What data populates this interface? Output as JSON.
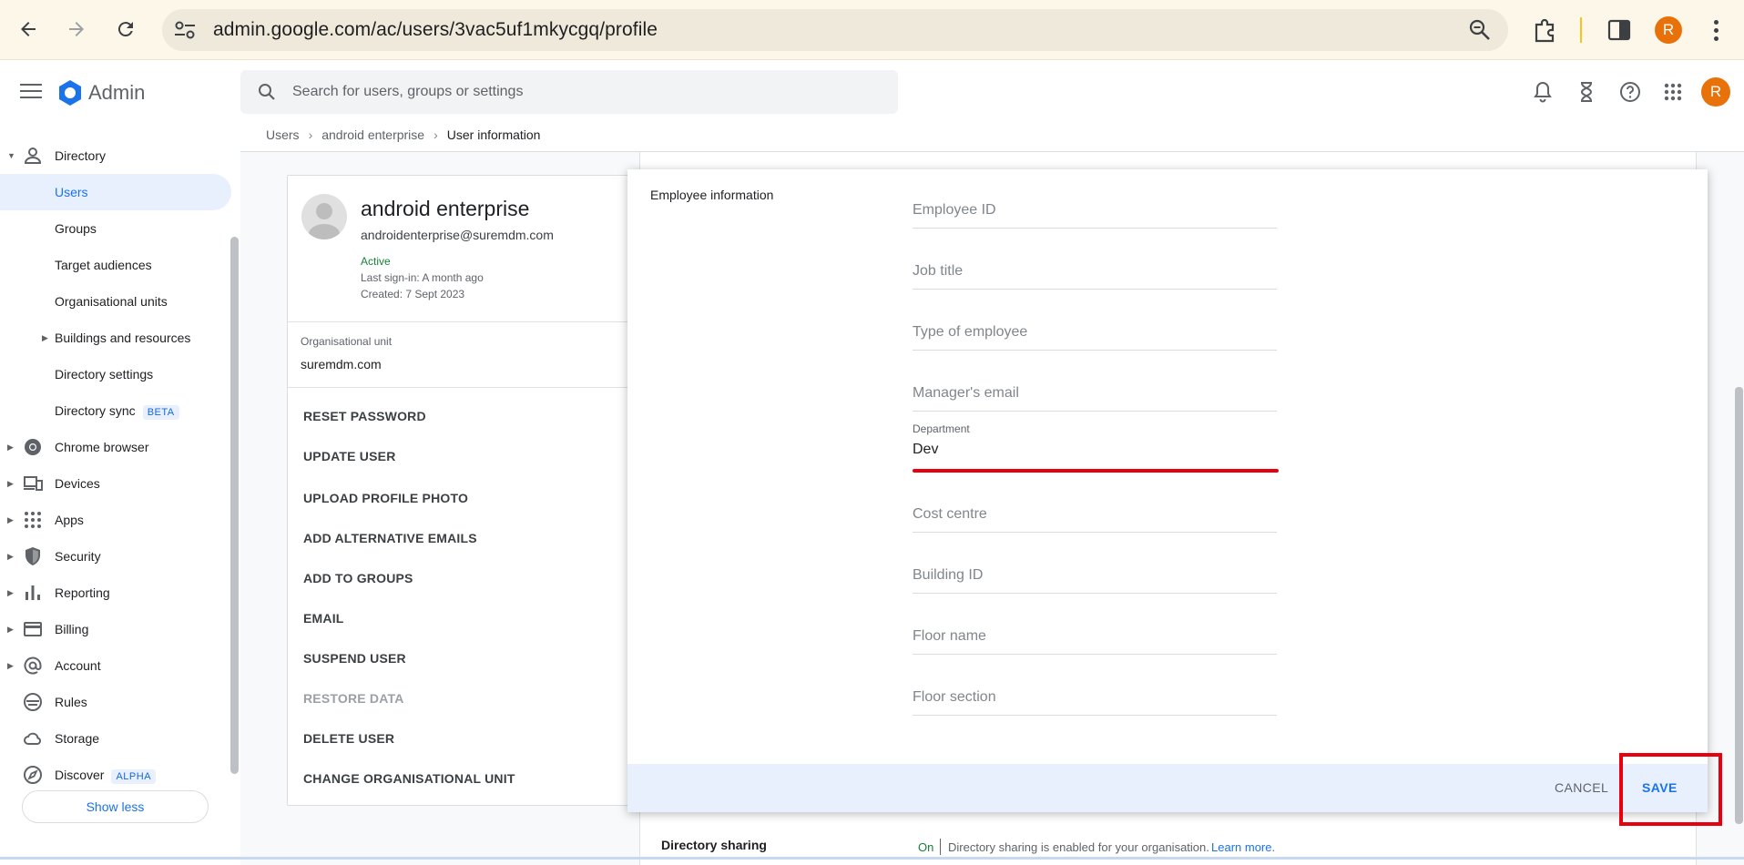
{
  "browser": {
    "url": "admin.google.com/ac/users/3vac5uf1mkycgq/profile",
    "profile_initial": "R"
  },
  "header": {
    "app_title": "Admin",
    "search_placeholder": "Search for users, groups or settings",
    "profile_initial": "R"
  },
  "breadcrumb": {
    "items": [
      "Users",
      "android enterprise",
      "User information"
    ]
  },
  "sidebar": {
    "items": [
      {
        "label": "Directory"
      },
      {
        "label": "Users"
      },
      {
        "label": "Groups"
      },
      {
        "label": "Target audiences"
      },
      {
        "label": "Organisational units"
      },
      {
        "label": "Buildings and resources"
      },
      {
        "label": "Directory settings"
      },
      {
        "label": "Directory sync",
        "badge": "BETA"
      },
      {
        "label": "Chrome browser"
      },
      {
        "label": "Devices"
      },
      {
        "label": "Apps"
      },
      {
        "label": "Security"
      },
      {
        "label": "Reporting"
      },
      {
        "label": "Billing"
      },
      {
        "label": "Account"
      },
      {
        "label": "Rules"
      },
      {
        "label": "Storage"
      },
      {
        "label": "Discover",
        "badge": "ALPHA"
      }
    ],
    "show_less": "Show less"
  },
  "user_card": {
    "name": "android enterprise",
    "email": "androidenterprise@suremdm.com",
    "status": "Active",
    "last_signin": "Last sign-in: A month ago",
    "created": "Created: 7 Sept 2023",
    "ou_label": "Organisational unit",
    "ou_value": "suremdm.com",
    "actions": [
      "RESET PASSWORD",
      "UPDATE USER",
      "UPLOAD PROFILE PHOTO",
      "ADD ALTERNATIVE EMAILS",
      "ADD TO GROUPS",
      "EMAIL",
      "SUSPEND USER",
      "RESTORE DATA",
      "DELETE USER",
      "CHANGE ORGANISATIONAL UNIT"
    ]
  },
  "dialog": {
    "section_title": "Employee information",
    "fields": {
      "employee_id": "Employee ID",
      "job_title": "Job title",
      "type_of_employee": "Type of employee",
      "managers_email": "Manager's email",
      "department_label": "Department",
      "department_value": "Dev",
      "cost_centre": "Cost centre",
      "building_id": "Building ID",
      "floor_name": "Floor name",
      "floor_section": "Floor section"
    },
    "cancel": "CANCEL",
    "save": "SAVE"
  },
  "directory_sharing": {
    "title": "Directory sharing",
    "status": "On",
    "text": "Directory sharing is enabled for your organisation.",
    "link": "Learn more."
  }
}
